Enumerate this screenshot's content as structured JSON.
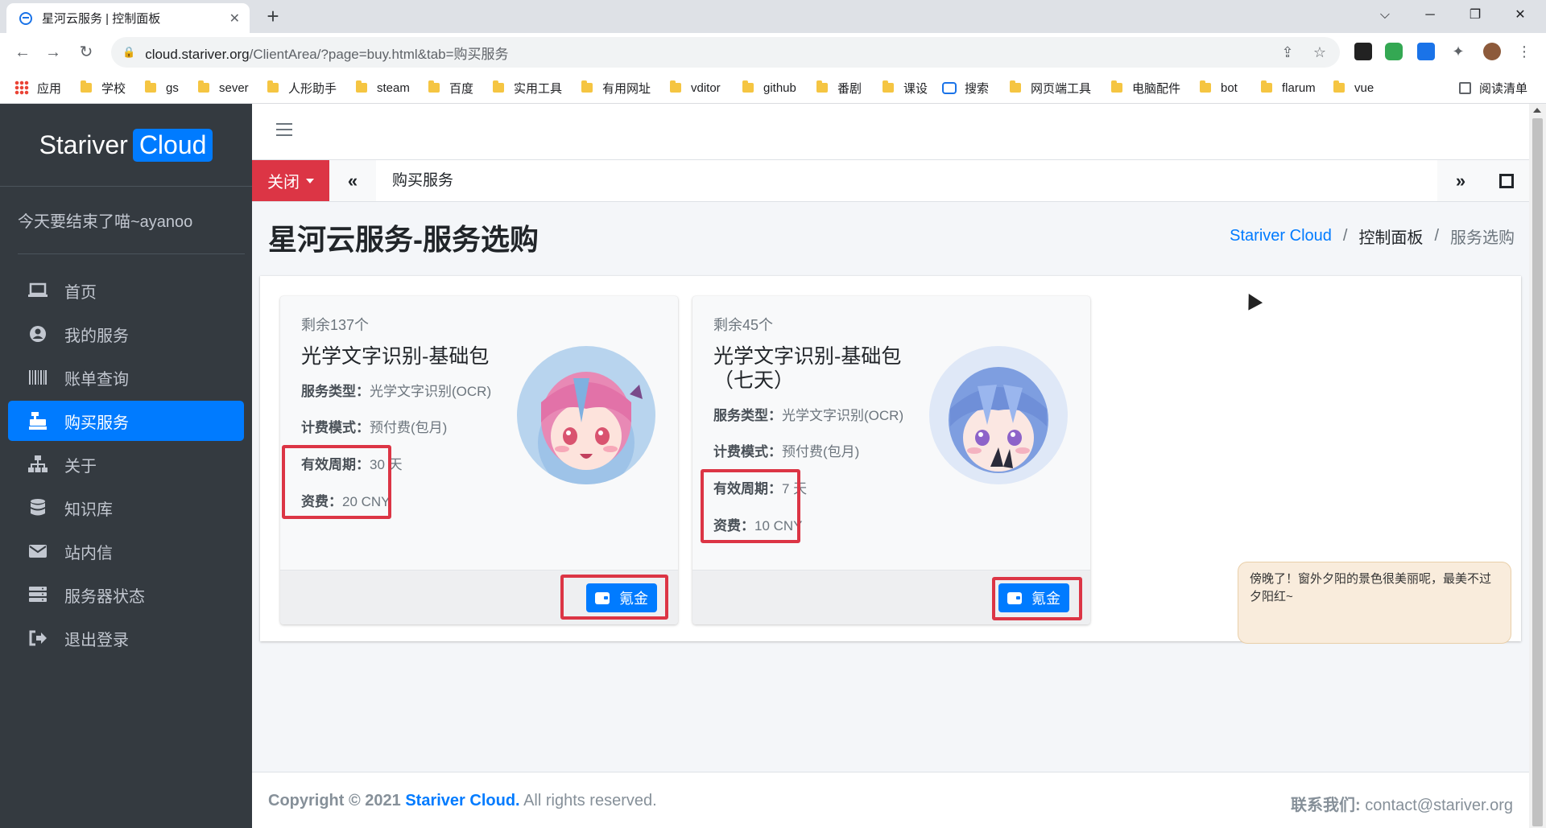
{
  "browser": {
    "tab_title": "星河云服务 | 控制面板",
    "url_host": "cloud.stariver.org",
    "url_path": "/ClientArea/?page=buy.html&tab=购买服务",
    "bookmarks": [
      "应用",
      "学校",
      "gs",
      "sever",
      "人形助手",
      "steam",
      "百度",
      "实用工具",
      "有用网址",
      "vditor",
      "github",
      "番剧",
      "课设",
      "搜索",
      "网页端工具",
      "电脑配件",
      "bot",
      "flarum",
      "vue"
    ],
    "reading_list": "阅读清单"
  },
  "sidebar": {
    "brand_text": "Stariver",
    "brand_badge": "Cloud",
    "user_greeting": "今天要结束了喵~ayanoo",
    "items": [
      {
        "label": "首页",
        "icon": "laptop-icon"
      },
      {
        "label": "我的服务",
        "icon": "user-circle-icon"
      },
      {
        "label": "账单查询",
        "icon": "barcode-icon"
      },
      {
        "label": "购买服务",
        "icon": "cash-register-icon"
      },
      {
        "label": "关于",
        "icon": "sitemap-icon"
      },
      {
        "label": "知识库",
        "icon": "database-icon"
      },
      {
        "label": "站内信",
        "icon": "envelope-icon"
      },
      {
        "label": "服务器状态",
        "icon": "server-icon"
      },
      {
        "label": "退出登录",
        "icon": "sign-out-icon"
      }
    ],
    "active_index": 3
  },
  "tabs": {
    "close_label": "关闭",
    "open_tab": "购买服务"
  },
  "page": {
    "title": "星河云服务-服务选购",
    "breadcrumb": [
      "Stariver Cloud",
      "控制面板",
      "服务选购"
    ]
  },
  "products": [
    {
      "remaining": "剩余137个",
      "name": "光学文字识别-基础包",
      "type_label": "服务类型：",
      "type_value": "光学文字识别(OCR)",
      "billing_label": "计费模式：",
      "billing_value": "预付费(包月)",
      "period_label": "有效周期：",
      "period_value": "30 天",
      "price_label": "资费：",
      "price_value": "20 CNY",
      "buy_label": "氪金"
    },
    {
      "remaining": "剩余45个",
      "name": "光学文字识别-基础包（七天）",
      "type_label": "服务类型：",
      "type_value": "光学文字识别(OCR)",
      "billing_label": "计费模式：",
      "billing_value": "预付费(包月)",
      "period_label": "有效周期：",
      "period_value": "7 天",
      "price_label": "资费：",
      "price_value": "10 CNY",
      "buy_label": "氪金"
    }
  ],
  "footer": {
    "copyright_prefix": "Copyright © 2021",
    "copyright_brand": "Stariver Cloud.",
    "copyright_suffix": "All rights reserved.",
    "contact_label": "联系我们:",
    "contact_email": "contact@stariver.org"
  },
  "tooltip": "傍晚了！窗外夕阳的景色很美丽呢，最美不过夕阳红~",
  "colors": {
    "primary": "#007bff",
    "danger": "#dc3545",
    "sidebar": "#343a40"
  }
}
